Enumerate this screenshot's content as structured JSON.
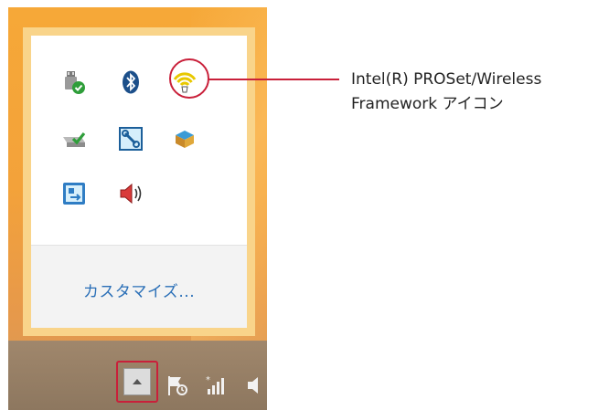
{
  "popup": {
    "icons": [
      {
        "name": "usb-safe-remove-icon"
      },
      {
        "name": "bluetooth-icon"
      },
      {
        "name": "intel-proset-wireless-icon"
      },
      {
        "name": "drive-check-icon"
      },
      {
        "name": "wrench-tool-icon"
      },
      {
        "name": "package-box-icon"
      },
      {
        "name": "input-language-icon"
      },
      {
        "name": "speaker-volume-icon"
      }
    ],
    "customize_label": "カスタマイズ..."
  },
  "taskbar": {
    "overflow_button_icon": "chevron-up-icon",
    "tray_icons": [
      "action-center-flag-icon",
      "network-signal-icon",
      "volume-icon"
    ]
  },
  "callout": {
    "line1": "Intel(R) PROSet/Wireless",
    "line2": "Framework アイコン"
  },
  "colors": {
    "highlight": "#c9203a",
    "link": "#2a6fb7",
    "popup_border": "#f9d48a",
    "desktop": "#f3a23a",
    "taskbar": "#93795f"
  }
}
